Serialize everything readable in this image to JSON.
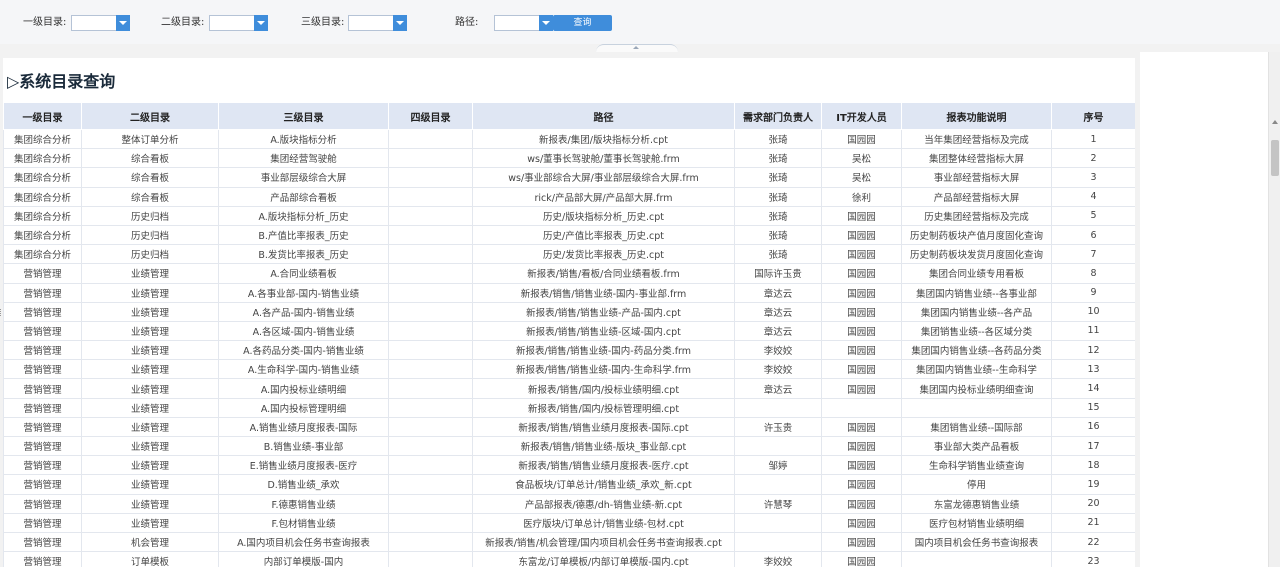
{
  "filters": {
    "level1_label": "一级目录:",
    "level2_label": "二级目录:",
    "level3_label": "三级目录:",
    "path_label": "路径:",
    "query_button": "查询"
  },
  "report": {
    "title": "▷系统目录查询",
    "columns": [
      "一级目录",
      "二级目录",
      "三级目录",
      "四级目录",
      "路径",
      "需求部门负责人",
      "IT开发人员",
      "报表功能说明",
      "序号"
    ],
    "rows": [
      [
        "集团综合分析",
        "整体订单分析",
        "A.版块指标分析",
        "",
        "新报表/集团/版块指标分析.cpt",
        "张琦",
        "国园园",
        "当年集团经营指标及完成",
        "1"
      ],
      [
        "集团综合分析",
        "综合看板",
        "集团经营驾驶舱",
        "",
        "ws/董事长驾驶舱/董事长驾驶舱.frm",
        "张琦",
        "吴松",
        "集团整体经营指标大屏",
        "2"
      ],
      [
        "集团综合分析",
        "综合看板",
        "事业部层级综合大屏",
        "",
        "ws/事业部综合大屏/事业部层级综合大屏.frm",
        "张琦",
        "吴松",
        "事业部经营指标大屏",
        "3"
      ],
      [
        "集团综合分析",
        "综合看板",
        "产品部综合看板",
        "",
        "rick/产品部大屏/产品部大屏.frm",
        "张琦",
        "徐利",
        "产品部经营指标大屏",
        "4"
      ],
      [
        "集团综合分析",
        "历史归档",
        "A.版块指标分析_历史",
        "",
        "历史/版块指标分析_历史.cpt",
        "张琦",
        "国园园",
        "历史集团经营指标及完成",
        "5"
      ],
      [
        "集团综合分析",
        "历史归档",
        "B.产值比率报表_历史",
        "",
        "历史/产值比率报表_历史.cpt",
        "张琦",
        "国园园",
        "历史制药板块产值月度固化查询",
        "6"
      ],
      [
        "集团综合分析",
        "历史归档",
        "B.发货比率报表_历史",
        "",
        "历史/发货比率报表_历史.cpt",
        "张琦",
        "国园园",
        "历史制药板块发货月度固化查询",
        "7"
      ],
      [
        "营销管理",
        "业绩管理",
        "A.合同业绩看板",
        "",
        "新报表/销售/看板/合同业绩看板.frm",
        "国际许玉贵",
        "国园园",
        "集团合同业绩专用看板",
        "8"
      ],
      [
        "营销管理",
        "业绩管理",
        "A.各事业部-国内-销售业绩",
        "",
        "新报表/销售/销售业绩-国内-事业部.frm",
        "章达云",
        "国园园",
        "集团国内销售业绩--各事业部",
        "9"
      ],
      [
        "营销管理",
        "业绩管理",
        "A.各产品-国内-销售业绩",
        "",
        "新报表/销售/销售业绩-产品-国内.cpt",
        "章达云",
        "国园园",
        "集团国内销售业绩--各产品",
        "10"
      ],
      [
        "营销管理",
        "业绩管理",
        "A.各区域-国内-销售业绩",
        "",
        "新报表/销售/销售业绩-区域-国内.cpt",
        "章达云",
        "国园园",
        "集团销售业绩--各区域分类",
        "11"
      ],
      [
        "营销管理",
        "业绩管理",
        "A.各药品分类-国内-销售业绩",
        "",
        "新报表/销售/销售业绩-国内-药品分类.frm",
        "李姣姣",
        "国园园",
        "集团国内销售业绩--各药品分类",
        "12"
      ],
      [
        "营销管理",
        "业绩管理",
        "A.生命科学-国内-销售业绩",
        "",
        "新报表/销售/销售业绩-国内-生命科学.frm",
        "李姣姣",
        "国园园",
        "集团国内销售业绩--生命科学",
        "13"
      ],
      [
        "营销管理",
        "业绩管理",
        "A.国内投标业绩明细",
        "",
        "新报表/销售/国内/投标业绩明细.cpt",
        "章达云",
        "国园园",
        "集团国内投标业绩明细查询",
        "14"
      ],
      [
        "营销管理",
        "业绩管理",
        "A.国内投标管理明细",
        "",
        "新报表/销售/国内/投标管理明细.cpt",
        "",
        "",
        "",
        "15"
      ],
      [
        "营销管理",
        "业绩管理",
        "A.销售业绩月度报表-国际",
        "",
        "新报表/销售/销售业绩月度报表-国际.cpt",
        "许玉贵",
        "国园园",
        "集团销售业绩--国际部",
        "16"
      ],
      [
        "营销管理",
        "业绩管理",
        "B.销售业绩-事业部",
        "",
        "新报表/销售/销售业绩-版块_事业部.cpt",
        "",
        "国园园",
        "事业部大类产品看板",
        "17"
      ],
      [
        "营销管理",
        "业绩管理",
        "E.销售业绩月度报表-医疗",
        "",
        "新报表/销售/销售业绩月度报表-医疗.cpt",
        "邹婷",
        "国园园",
        "生命科学销售业绩查询",
        "18"
      ],
      [
        "营销管理",
        "业绩管理",
        "D.销售业绩_承欢",
        "",
        "食品板块/订单总计/销售业绩_承欢_新.cpt",
        "",
        "国园园",
        "停用",
        "19"
      ],
      [
        "营销管理",
        "业绩管理",
        "F.德惠销售业绩",
        "",
        "产品部报表/德惠/dh-销售业绩-新.cpt",
        "许慧琴",
        "国园园",
        "东富龙德惠销售业绩",
        "20"
      ],
      [
        "营销管理",
        "业绩管理",
        "F.包材销售业绩",
        "",
        "医疗版块/订单总计/销售业绩-包材.cpt",
        "",
        "国园园",
        "医疗包材销售业绩明细",
        "21"
      ],
      [
        "营销管理",
        "机会管理",
        "A.国内项目机会任务书查询报表",
        "",
        "新报表/销售/机会管理/国内项目机会任务书查询报表.cpt",
        "",
        "国园园",
        "国内项目机会任务书查询报表",
        "22"
      ],
      [
        "营销管理",
        "订单模板",
        "内部订单模版-国内",
        "",
        "东富龙/订单模板/内部订单模版-国内.cpt",
        "李姣姣",
        "国园园",
        "",
        "23"
      ]
    ]
  }
}
